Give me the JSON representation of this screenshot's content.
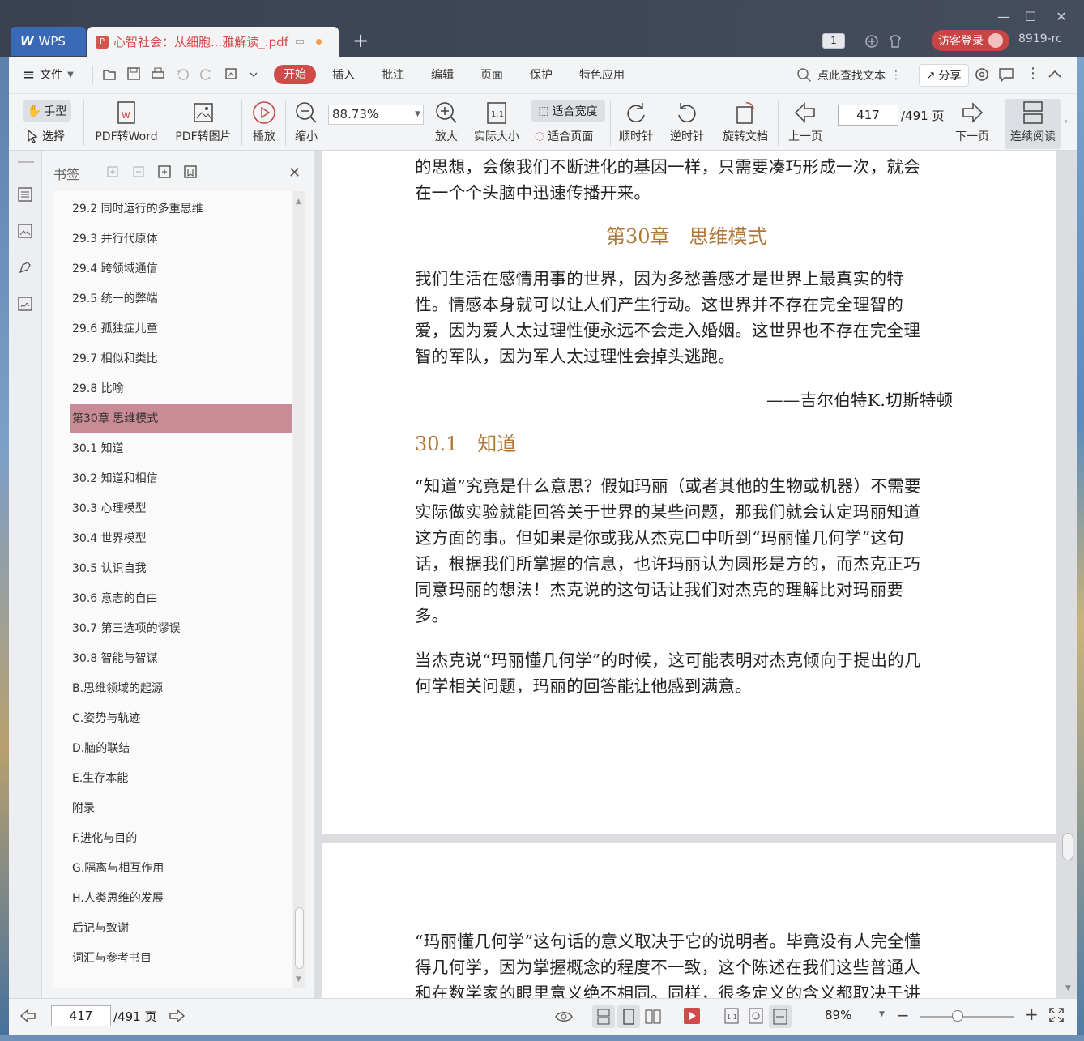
{
  "titlebar": {
    "wps_label": "WPS",
    "doc_tab_title": "心智社会：从细胞...雅解读_.pdf",
    "tab_count": "1",
    "login_label": "访客登录",
    "user_id": "8919-rc"
  },
  "menu": {
    "file": "文件",
    "tabs": [
      "开始",
      "插入",
      "批注",
      "编辑",
      "页面",
      "保护",
      "特色应用"
    ],
    "search_text": "点此查找文本",
    "share": "分享"
  },
  "toolbar": {
    "hand": "手型",
    "select": "选择",
    "pdf_to_word": "PDF转Word",
    "pdf_to_image": "PDF转图片",
    "play": "播放",
    "zoom_out": "缩小",
    "zoom_value": "88.73%",
    "zoom_in": "放大",
    "actual_size": "实际大小",
    "fit_width": "适合宽度",
    "fit_page": "适合页面",
    "rotate_cw": "顺时针",
    "rotate_ccw": "逆时针",
    "rotate_doc": "旋转文档",
    "prev_page": "上一页",
    "current_page": "417",
    "total_pages": "/491 页",
    "next_page": "下一页",
    "continuous": "连续阅读"
  },
  "bookmarks": {
    "title": "书签",
    "items": [
      "29.2 同时运行的多重思维",
      "29.3 并行代原体",
      "29.4 跨领域通信",
      "29.5 统一的弊端",
      "29.6 孤独症儿童",
      "29.7 相似和类比",
      "29.8 比喻",
      "第30章 思维模式",
      "30.1 知道",
      "30.2 知道和相信",
      "30.3 心理模型",
      "30.4 世界模型",
      "30.5 认识自我",
      "30.6 意志的自由",
      "30.7 第三选项的谬误",
      "30.8 智能与智谋",
      "B.思维领域的起源",
      "C.姿势与轨迹",
      "D.脑的联结",
      "E.生存本能",
      "附录",
      "F.进化与目的",
      "G.隔离与相互作用",
      "H.人类思维的发展",
      "后记与致谢",
      "词汇与参考书目"
    ],
    "selected_index": 7
  },
  "document": {
    "page1_lines_top": [
      "的思想，会像我们不断进化的基因一样，只需要凑巧形成一次，就会",
      "在一个个头脑中迅速传播开来。"
    ],
    "chapter_title": "第30章　思维模式",
    "epigraph_lines": [
      "我们生活在感情用事的世界，因为多愁善感才是世界上最真实的特",
      "性。情感本身就可以让人们产生行动。这世界并不存在完全理智的",
      "爱，因为爱人太过理性便永远不会走入婚姻。这世界也不存在完全理",
      "智的军队，因为军人太过理性会掉头逃跑。"
    ],
    "epigraph_author": "——吉尔伯特K.切斯特顿",
    "section_title": "30.1　知道",
    "para1_lines": [
      "“知道”究竟是什么意思？假如玛丽（或者其他的生物或机器）不需要",
      "实际做实验就能回答关于世界的某些问题，那我们就会认定玛丽知道",
      "这方面的事。但如果是你或我从杰克口中听到“玛丽懂几何学”这句",
      "话，根据我们所掌握的信息，也许玛丽认为圆形是方的，而杰克正巧",
      "同意玛丽的想法！杰克说的这句话让我们对杰克的理解比对玛丽要",
      "多。"
    ],
    "para2_lines": [
      "当杰克说“玛丽懂几何学”的时候，这可能表明对杰克倾向于提出的几",
      "何学相关问题，玛丽的回答能让他感到满意。"
    ],
    "page2_lines": [
      "“玛丽懂几何学”这句话的意义取决于它的说明者。毕竟没有人完全懂",
      "得几何学，因为掌握概念的程度不一致，这个陈述在我们这些普通人",
      "和在数学家的眼里意义绝不相同。同样，很多定义的含义都取决于讲"
    ]
  },
  "statusbar": {
    "current_page": "417",
    "total_pages": "/491 页",
    "zoom": "89%",
    "zoom_level": 0.4
  },
  "colors": {
    "accent": "#d04a4a",
    "heading": "#b07838",
    "selected_bookmark": "#c98c96"
  }
}
